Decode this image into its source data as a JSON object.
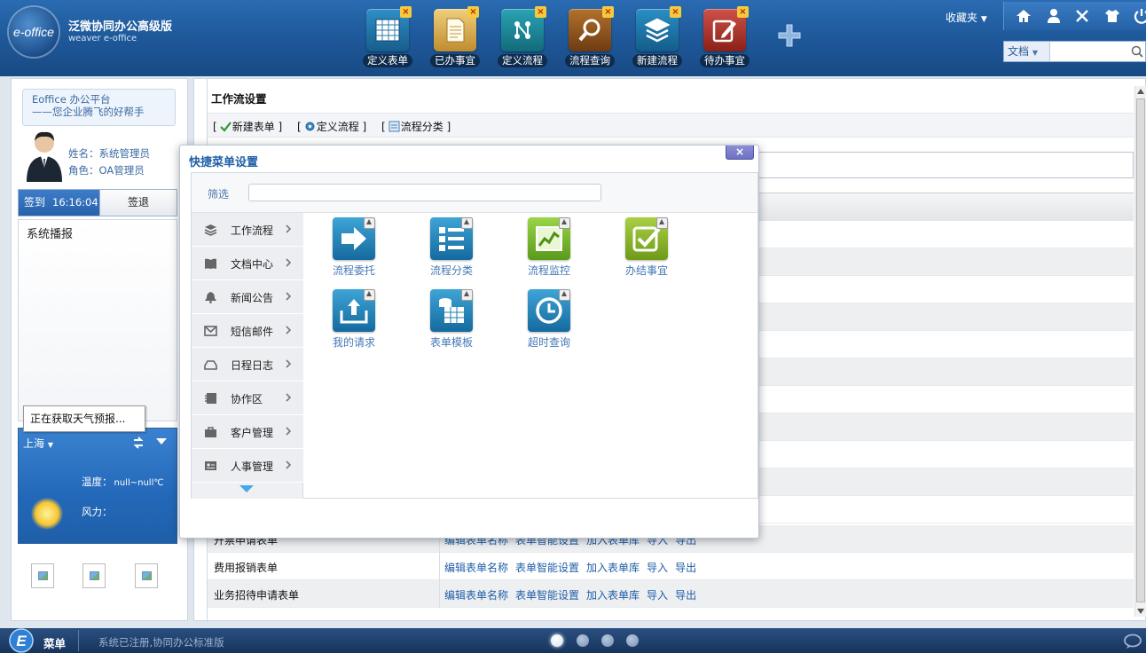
{
  "app": {
    "logo_text": "e-office",
    "name": "泛微协同办公高级版",
    "subname": "weaver e-office"
  },
  "shortcuts": [
    {
      "label": "定义表单",
      "icon": "table-form-icon",
      "color": "#1f6fa3"
    },
    {
      "label": "已办事宜",
      "icon": "document-done-icon",
      "color": "#c99a3c"
    },
    {
      "label": "定义流程",
      "icon": "flow-define-icon",
      "color": "#1b7b8c"
    },
    {
      "label": "流程查询",
      "icon": "magnifier-icon",
      "color": "#8a4d1f"
    },
    {
      "label": "新建流程",
      "icon": "layers-icon",
      "color": "#1b6c93"
    },
    {
      "label": "待办事宜",
      "icon": "pen-edit-icon",
      "color": "#b33a32"
    }
  ],
  "header": {
    "favorites_label": "收藏夹",
    "search_category": "文档",
    "search_value": ""
  },
  "sidebar": {
    "slogan_line1": "Eoffice 办公平台",
    "slogan_line2": "——您企业腾飞的好帮手",
    "user_name": "姓名：系统管理员",
    "user_role": "角色：OA管理员",
    "signin_label": "签到",
    "signin_time": "16:16:04",
    "signout_label": "签退",
    "broadcast_title": "系统播报",
    "weather": {
      "city": "上海",
      "temp_label": "温度：",
      "temp_value": "null~null℃",
      "wind_label": "风力：",
      "loading_tip": "正在获取天气预报..."
    }
  },
  "main": {
    "title": "工作流设置",
    "toolbar": [
      {
        "label": "新建表单"
      },
      {
        "label": "定义流程"
      },
      {
        "label": "流程分类"
      }
    ],
    "rows": [
      {
        "name": "开票申请表单",
        "actions": [
          "编辑表单名称",
          "表单智能设置",
          "加入表单库",
          "导入",
          "导出"
        ]
      },
      {
        "name": "费用报销表单",
        "actions": [
          "编辑表单名称",
          "表单智能设置",
          "加入表单库",
          "导入",
          "导出"
        ]
      },
      {
        "name": "业务招待申请表单",
        "actions": [
          "编辑表单名称",
          "表单智能设置",
          "加入表单库",
          "导入",
          "导出"
        ]
      }
    ]
  },
  "modal": {
    "title": "快捷菜单设置",
    "close_label": "×",
    "filter_label": "筛选",
    "filter_value": "",
    "categories": [
      {
        "label": "工作流程",
        "icon": "layers-icon"
      },
      {
        "label": "文档中心",
        "icon": "book-icon"
      },
      {
        "label": "新闻公告",
        "icon": "bell-icon"
      },
      {
        "label": "短信邮件",
        "icon": "mail-icon"
      },
      {
        "label": "日程日志",
        "icon": "tray-icon"
      },
      {
        "label": "协作区",
        "icon": "notebook-icon"
      },
      {
        "label": "客户管理",
        "icon": "bag-icon"
      },
      {
        "label": "人事管理",
        "icon": "id-card-icon"
      }
    ],
    "apps": [
      {
        "label": "流程委托",
        "icon": "arrow-right-icon",
        "color": "#1e7fb0"
      },
      {
        "label": "流程分类",
        "icon": "list-icon",
        "color": "#1e7fb0"
      },
      {
        "label": "流程监控",
        "icon": "chart-line-icon",
        "color": "#7dbb2e"
      },
      {
        "label": "办结事宜",
        "icon": "checkbox-icon",
        "color": "#8bb52a"
      },
      {
        "label": "我的请求",
        "icon": "upload-tray-icon",
        "color": "#1e7fb0"
      },
      {
        "label": "表单模板",
        "icon": "table-db-icon",
        "color": "#1e7fb0"
      },
      {
        "label": "超时查询",
        "icon": "clock-icon",
        "color": "#1e7fb0"
      }
    ]
  },
  "taskbar": {
    "menu_label": "菜单",
    "status_text": "系统已注册,协同办公标准版",
    "active_dot": 0
  }
}
